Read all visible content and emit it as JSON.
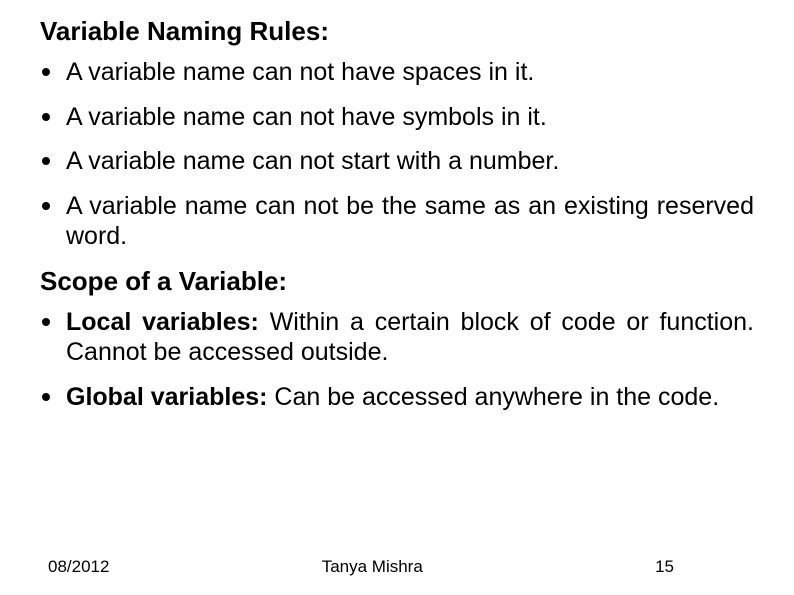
{
  "headings": {
    "naming": "Variable Naming Rules:",
    "scope": "Scope of a Variable:"
  },
  "rules": [
    "A variable name can not have spaces in it.",
    "A variable name can not have symbols in it.",
    "A variable name can not start with a number.",
    "A variable name can not be the same as an existing reserved word."
  ],
  "scope": [
    {
      "lead": "Local variables: ",
      "rest": "Within a certain block of code or function. Cannot be accessed outside."
    },
    {
      "lead": "Global variables: ",
      "rest": "Can be accessed anywhere in the code."
    }
  ],
  "footer": {
    "date": "08/2012",
    "author": "Tanya Mishra",
    "page": "15"
  }
}
